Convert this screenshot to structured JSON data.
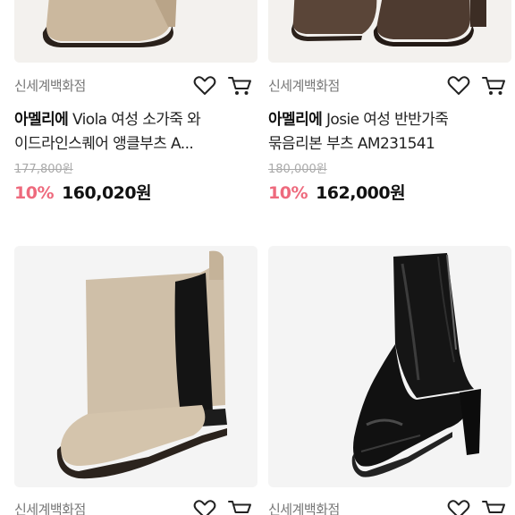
{
  "products": [
    {
      "store": "신세계백화점",
      "brand": "아멜리에",
      "title_line1": "Viola 여성 소가죽 와",
      "title_line2": "이드라인스퀘어 앵클부츠 A...",
      "original_price": "177,800원",
      "discount": "10%",
      "price": "160,020원",
      "image_icon": "brown-square-toe-boot-image"
    },
    {
      "store": "신세계백화점",
      "brand": "아멜리에",
      "title_line1": "Josie 여성 반반가죽",
      "title_line2": "묶음리본 부츠 AM231541",
      "original_price": "180,000원",
      "discount": "10%",
      "price": "162,000원",
      "image_icon": "dark-brown-boots-image"
    },
    {
      "store": "신세계백화점",
      "image_icon": "beige-chelsea-boot-image"
    },
    {
      "store": "신세계백화점",
      "image_icon": "black-patent-ankle-boot-image"
    }
  ],
  "icons": {
    "wishlist": "heart-icon",
    "cart": "cart-icon"
  },
  "colors": {
    "discount": "#ee6a7d",
    "store_text": "#777777",
    "strike_text": "#aaaaaa"
  }
}
